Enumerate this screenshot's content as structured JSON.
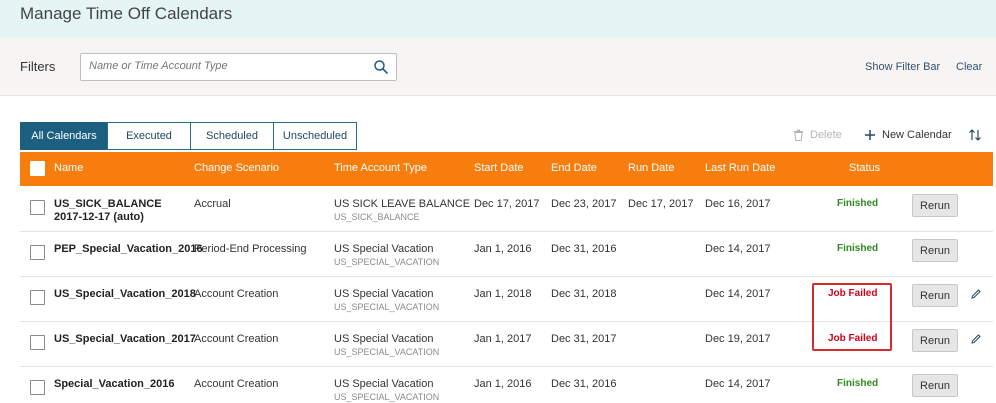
{
  "page": {
    "title": "Manage Time Off Calendars"
  },
  "filters": {
    "label": "Filters",
    "search_placeholder": "Name or Time Account Type",
    "show_filter_bar": "Show Filter Bar",
    "clear": "Clear"
  },
  "tabs": [
    {
      "label": "All Calendars",
      "active": true
    },
    {
      "label": "Executed",
      "active": false
    },
    {
      "label": "Scheduled",
      "active": false
    },
    {
      "label": "Unscheduled",
      "active": false
    }
  ],
  "toolbar": {
    "delete_label": "Delete",
    "new_calendar_label": "New Calendar"
  },
  "table": {
    "headers": {
      "name": "Name",
      "change_scenario": "Change Scenario",
      "time_account_type": "Time Account Type",
      "start_date": "Start Date",
      "end_date": "End Date",
      "run_date": "Run Date",
      "last_run_date": "Last Run Date",
      "status": "Status"
    },
    "rows": [
      {
        "name": "US_SICK_BALANCE 2017-12-17 (auto)",
        "change_scenario": "Accrual",
        "time_account_type": "US SICK LEAVE BALANCE",
        "time_account_code": "US_SICK_BALANCE",
        "start_date": "Dec 17, 2017",
        "end_date": "Dec 23, 2017",
        "run_date": "Dec 17, 2017",
        "last_run_date": "Dec 16, 2017",
        "status": "Finished",
        "action": "Rerun"
      },
      {
        "name": "PEP_Special_Vacation_2016",
        "change_scenario": "Period-End Processing",
        "time_account_type": "US Special Vacation",
        "time_account_code": "US_SPECIAL_VACATION",
        "start_date": "Jan 1, 2016",
        "end_date": "Dec 31, 2016",
        "run_date": "",
        "last_run_date": "Dec 14, 2017",
        "status": "Finished",
        "action": "Rerun"
      },
      {
        "name": "US_Special_Vacation_2018",
        "change_scenario": "Account Creation",
        "time_account_type": "US Special Vacation",
        "time_account_code": "US_SPECIAL_VACATION",
        "start_date": "Jan 1, 2018",
        "end_date": "Dec 31, 2018",
        "run_date": "",
        "last_run_date": "Dec 14, 2017",
        "status": "Job Failed",
        "action": "Rerun"
      },
      {
        "name": "US_Special_Vacation_2017",
        "change_scenario": "Account Creation",
        "time_account_type": "US Special Vacation",
        "time_account_code": "US_SPECIAL_VACATION",
        "start_date": "Jan 1, 2017",
        "end_date": "Dec 31, 2017",
        "run_date": "",
        "last_run_date": "Dec 19, 2017",
        "status": "Job Failed",
        "action": "Rerun"
      },
      {
        "name": "Special_Vacation_2016",
        "change_scenario": "Account Creation",
        "time_account_type": "US Special Vacation",
        "time_account_code": "US_SPECIAL_VACATION",
        "start_date": "Jan 1, 2016",
        "end_date": "Dec 31, 2016",
        "run_date": "",
        "last_run_date": "Dec 14, 2017",
        "status": "Finished",
        "action": "Rerun"
      }
    ]
  },
  "colors": {
    "header_orange": "#f77e0e",
    "tab_active": "#1c5f80",
    "status_finished": "#2e8b1f",
    "status_failed": "#d0021b",
    "highlight_border": "#d62b2b"
  },
  "icons": {
    "search": "search-icon",
    "delete": "trash-icon",
    "new": "plus-icon",
    "sort": "sort-icon",
    "edit": "pencil-icon"
  }
}
